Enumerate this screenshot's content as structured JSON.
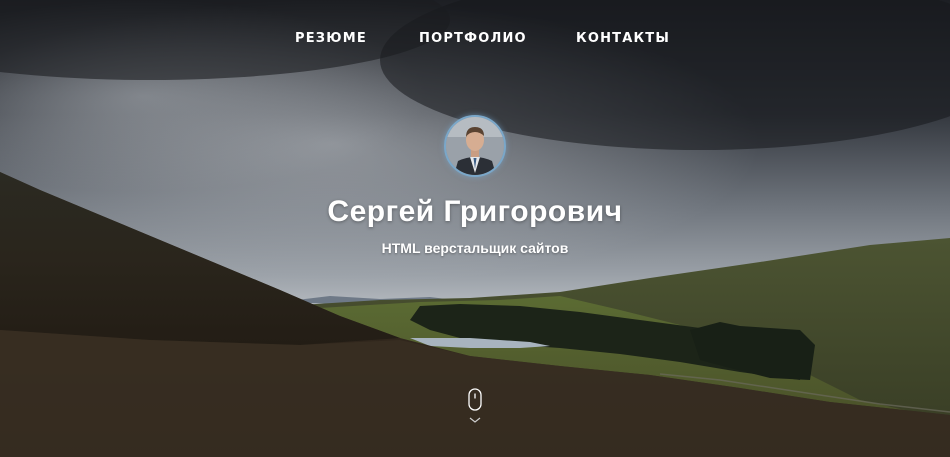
{
  "nav": {
    "items": [
      {
        "label": "РЕЗЮМЕ"
      },
      {
        "label": "ПОРТФОЛИО"
      },
      {
        "label": "КОНТАКТЫ"
      }
    ]
  },
  "profile": {
    "name": "Сергей Григорович",
    "title": "HTML верстальщик сайтов"
  },
  "icons": {
    "scroll": "mouse-scroll-icon",
    "chevron": "chevron-down-icon"
  },
  "colors": {
    "text": "#ffffff",
    "avatar_border": "#7aa7c9"
  }
}
